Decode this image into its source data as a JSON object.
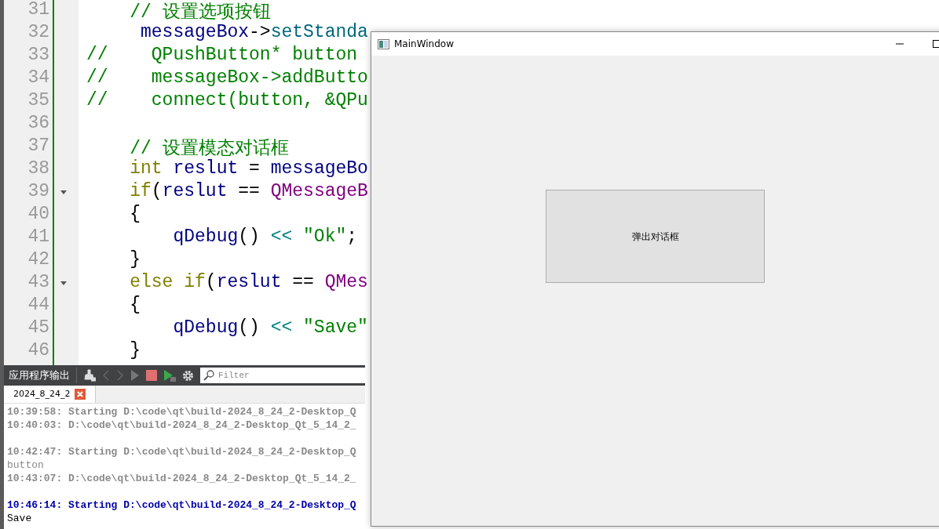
{
  "editor": {
    "lines": [
      {
        "number": "31",
        "fold": false,
        "tokens": [
          {
            "t": "    // 设置选项按钮",
            "kind": "comment"
          }
        ]
      },
      {
        "number": "32",
        "fold": false,
        "tokens": [
          {
            "t": "     messageBox",
            "kind": "ident"
          },
          {
            "t": "->",
            "kind": "plain"
          },
          {
            "t": "setStanda",
            "kind": "func"
          }
        ]
      },
      {
        "number": "33",
        "fold": false,
        "tokens": [
          {
            "t": "//    QPushButton* button",
            "kind": "comment"
          }
        ]
      },
      {
        "number": "34",
        "fold": false,
        "tokens": [
          {
            "t": "//    messageBox->addButto",
            "kind": "comment"
          }
        ]
      },
      {
        "number": "35",
        "fold": false,
        "tokens": [
          {
            "t": "//    connect(button, &QPu",
            "kind": "comment"
          }
        ]
      },
      {
        "number": "36",
        "fold": false
      },
      {
        "number": "37",
        "fold": false,
        "tokens": [
          {
            "t": "    // 设置模态对话框",
            "kind": "comment"
          }
        ]
      },
      {
        "number": "38",
        "fold": false,
        "tokens": [
          {
            "t": "    int",
            "kind": "keyword"
          },
          {
            "t": " reslut",
            "kind": "ident"
          },
          {
            "t": " = ",
            "kind": "plain"
          },
          {
            "t": "messageBo",
            "kind": "ident"
          }
        ]
      },
      {
        "number": "39",
        "fold": true,
        "tokens": [
          {
            "t": "    if",
            "kind": "keyword"
          },
          {
            "t": "(",
            "kind": "plain"
          },
          {
            "t": "reslut",
            "kind": "ident"
          },
          {
            "t": " == ",
            "kind": "plain"
          },
          {
            "t": "QMessageB",
            "kind": "type"
          }
        ]
      },
      {
        "number": "40",
        "fold": false,
        "tokens": [
          {
            "t": "    {",
            "kind": "plain"
          }
        ]
      },
      {
        "number": "41",
        "fold": false,
        "tokens": [
          {
            "t": "        qDebug",
            "kind": "ident"
          },
          {
            "t": "() ",
            "kind": "plain"
          },
          {
            "t": "<<",
            "kind": "op"
          },
          {
            "t": " \"Ok\"",
            "kind": "string"
          },
          {
            "t": ";",
            "kind": "plain"
          }
        ]
      },
      {
        "number": "42",
        "fold": false,
        "tokens": [
          {
            "t": "    }",
            "kind": "plain"
          }
        ]
      },
      {
        "number": "43",
        "fold": true,
        "tokens": [
          {
            "t": "    else if",
            "kind": "keyword"
          },
          {
            "t": "(",
            "kind": "plain"
          },
          {
            "t": "reslut",
            "kind": "ident"
          },
          {
            "t": " == ",
            "kind": "plain"
          },
          {
            "t": "QMes",
            "kind": "type"
          }
        ]
      },
      {
        "number": "44",
        "fold": false,
        "tokens": [
          {
            "t": "    {",
            "kind": "plain"
          }
        ]
      },
      {
        "number": "45",
        "fold": false,
        "tokens": [
          {
            "t": "        qDebug",
            "kind": "ident"
          },
          {
            "t": "() ",
            "kind": "plain"
          },
          {
            "t": "<<",
            "kind": "op"
          },
          {
            "t": " \"Save\"",
            "kind": "string"
          }
        ]
      },
      {
        "number": "46",
        "fold": false,
        "tokens": [
          {
            "t": "    }",
            "kind": "plain"
          }
        ]
      }
    ]
  },
  "output_pane": {
    "title": "应用程序输出",
    "filter": {
      "placeholder": "Filter"
    },
    "tabs": [
      {
        "label": "2024_8_24_2",
        "selected": true
      }
    ],
    "lines": [
      {
        "text": "10:39:58: Starting D:\\code\\qt\\build-2024_8_24_2-Desktop_Q",
        "kind": "log",
        "gap_before": false
      },
      {
        "text": "10:40:03: D:\\code\\qt\\build-2024_8_24_2-Desktop_Qt_5_14_2_",
        "kind": "log",
        "gap_before": false
      },
      {
        "text": "10:42:47: Starting D:\\code\\qt\\build-2024_8_24_2-Desktop_Q",
        "kind": "log",
        "gap_before": true
      },
      {
        "text": "button",
        "kind": "output",
        "gap_before": false
      },
      {
        "text": "10:43:07: D:\\code\\qt\\build-2024_8_24_2-Desktop_Qt_5_14_2_",
        "kind": "log",
        "gap_before": false
      },
      {
        "text": "10:46:14: Starting D:\\code\\qt\\build-2024_8_24_2-Desktop_Q",
        "kind": "log_current",
        "gap_before": true
      },
      {
        "text": "Save",
        "kind": "output_current",
        "gap_before": false
      }
    ]
  },
  "window": {
    "title": "MainWindow",
    "button": "弹出对话框"
  }
}
